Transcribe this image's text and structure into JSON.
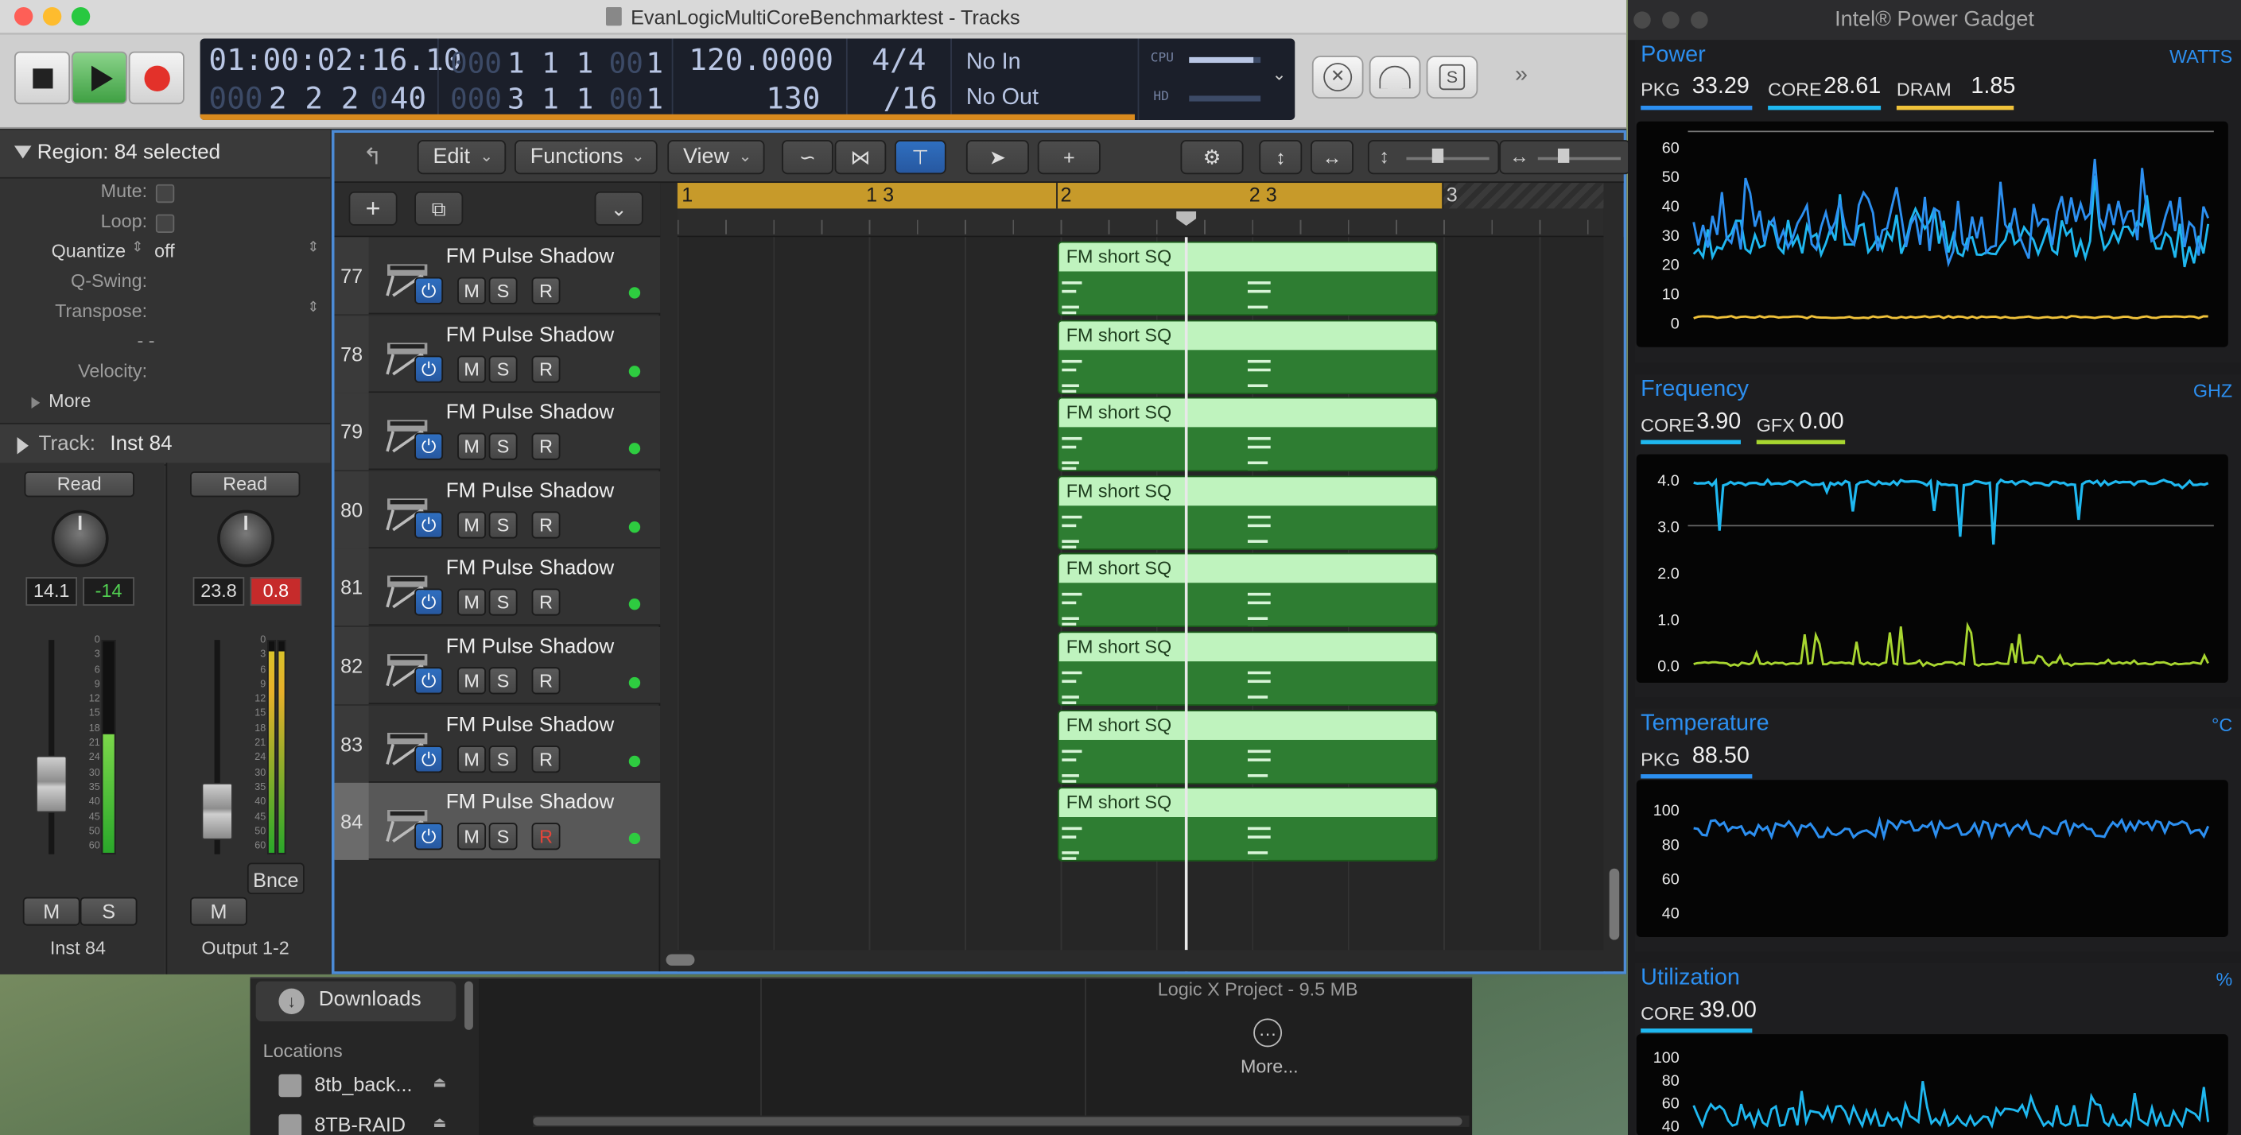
{
  "window": {
    "title": "EvanLogicMultiCoreBenchmarktest - Tracks"
  },
  "lcd": {
    "position": "01:00:02:16.10",
    "bars_dim_top": "000",
    "bars_top": "1  1  1",
    "bars_dim_top2": "00",
    "bars_top_last": "1",
    "pos_bottom_dim": "000",
    "pos_bottom": "2  2  2",
    "pos_bottom_dim2": "0",
    "pos_bottom_last": "40",
    "bars_bottom_dim": "000",
    "bars_bottom": "3  1  1",
    "bars_bottom_dim2": "00",
    "bars_bottom_last": "1",
    "tempo": "120.0000",
    "tempo_bottom": "130",
    "sig_top": "4/4",
    "sig_bottom": "/16",
    "in_label": "No In",
    "out_label": "No Out",
    "cpu_label": "CPU",
    "hd_label": "HD"
  },
  "inspector": {
    "region_header": "Region: 84 selected",
    "mute": "Mute:",
    "loop": "Loop:",
    "quantize": "Quantize",
    "quantize_value": "off",
    "qswing": "Q-Swing:",
    "transpose": "Transpose:",
    "dashes": "-  -",
    "velocity": "Velocity:",
    "more": "More",
    "track_header": "Track:",
    "track_name": "Inst 84"
  },
  "strips": [
    {
      "read": "Read",
      "val1": "14.1",
      "val2": "-14",
      "name": "Inst 84",
      "btn_m": "M",
      "btn_s": "S"
    },
    {
      "read": "Read",
      "val1": "23.8",
      "val2": "0.8",
      "name": "Output 1-2",
      "btn_m": "M",
      "bnce": "Bnce"
    }
  ],
  "meter_scale": [
    "0",
    "3",
    "6",
    "9",
    "12",
    "15",
    "18",
    "21",
    "24",
    "30",
    "35",
    "40",
    "45",
    "50",
    "60"
  ],
  "toolbar": {
    "edit": "Edit",
    "functions": "Functions",
    "view": "View"
  },
  "ruler": {
    "m1": "1",
    "m13": "1 3",
    "m2": "2",
    "m23": "2 3",
    "m3": "3"
  },
  "tracks": [
    {
      "num": "77",
      "name": "FM Pulse Shadow",
      "region": "FM short SQ"
    },
    {
      "num": "78",
      "name": "FM Pulse Shadow",
      "region": "FM short SQ"
    },
    {
      "num": "79",
      "name": "FM Pulse Shadow",
      "region": "FM short SQ"
    },
    {
      "num": "80",
      "name": "FM Pulse Shadow",
      "region": "FM short SQ"
    },
    {
      "num": "81",
      "name": "FM Pulse Shadow",
      "region": "FM short SQ"
    },
    {
      "num": "82",
      "name": "FM Pulse Shadow",
      "region": "FM short SQ"
    },
    {
      "num": "83",
      "name": "FM Pulse Shadow",
      "region": "FM short SQ"
    },
    {
      "num": "84",
      "name": "FM Pulse Shadow",
      "region": "FM short SQ"
    }
  ],
  "track_buttons": {
    "m": "M",
    "s": "S",
    "r": "R"
  },
  "browser": {
    "downloads": "Downloads",
    "locations": "Locations",
    "loc1": "8tb_back...",
    "loc2": "8TB-RAID",
    "project": "Logic X Project - 9.5 MB",
    "more": "More..."
  },
  "gadget": {
    "title": "Intel® Power Gadget",
    "power": {
      "head": "Power",
      "unit": "WATTS",
      "pkg_lbl": "PKG",
      "pkg": "33.29",
      "core_lbl": "CORE",
      "core": "28.61",
      "dram_lbl": "DRAM",
      "dram": "1.85",
      "axis": [
        "60",
        "50",
        "40",
        "30",
        "20",
        "10",
        "0"
      ]
    },
    "frequency": {
      "head": "Frequency",
      "unit": "GHZ",
      "core_lbl": "CORE",
      "core": "3.90",
      "gfx_lbl": "GFX",
      "gfx": "0.00",
      "axis": [
        "4.0",
        "3.0",
        "2.0",
        "1.0",
        "0.0"
      ]
    },
    "temperature": {
      "head": "Temperature",
      "unit": "°C",
      "pkg_lbl": "PKG",
      "pkg": "88.50",
      "axis": [
        "100",
        "80",
        "60",
        "40"
      ]
    },
    "utilization": {
      "head": "Utilization",
      "unit": "%",
      "core_lbl": "CORE",
      "core": "39.00",
      "axis": [
        "100",
        "80",
        "60",
        "40"
      ]
    }
  },
  "colors": {
    "accent": "#2c8ff0",
    "region_green": "#2e7d32",
    "region_head": "#bff3be",
    "ruler": "#c79a2a",
    "gadget_yellow": "#f0c23a",
    "gadget_lime": "#a8d630"
  }
}
